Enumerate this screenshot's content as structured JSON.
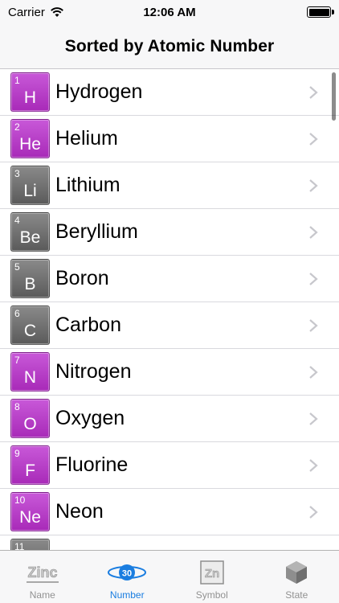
{
  "status_bar": {
    "carrier": "Carrier",
    "time": "12:06 AM"
  },
  "nav": {
    "title": "Sorted by Atomic Number"
  },
  "elements": [
    {
      "number": "1",
      "symbol": "H",
      "name": "Hydrogen",
      "category": "nonmetal"
    },
    {
      "number": "2",
      "symbol": "He",
      "name": "Helium",
      "category": "nonmetal"
    },
    {
      "number": "3",
      "symbol": "Li",
      "name": "Lithium",
      "category": "metalloid"
    },
    {
      "number": "4",
      "symbol": "Be",
      "name": "Beryllium",
      "category": "metalloid"
    },
    {
      "number": "5",
      "symbol": "B",
      "name": "Boron",
      "category": "metalloid"
    },
    {
      "number": "6",
      "symbol": "C",
      "name": "Carbon",
      "category": "metalloid"
    },
    {
      "number": "7",
      "symbol": "N",
      "name": "Nitrogen",
      "category": "nonmetal"
    },
    {
      "number": "8",
      "symbol": "O",
      "name": "Oxygen",
      "category": "nonmetal"
    },
    {
      "number": "9",
      "symbol": "F",
      "name": "Fluorine",
      "category": "nonmetal"
    },
    {
      "number": "10",
      "symbol": "Ne",
      "name": "Neon",
      "category": "nonmetal"
    },
    {
      "number": "11",
      "symbol": "",
      "name": "",
      "category": "metalloid"
    }
  ],
  "tabs": [
    {
      "label": "Name",
      "icon": "zinc-name-icon",
      "icon_text": "Zinc",
      "active": false
    },
    {
      "label": "Number",
      "icon": "atomic-number-icon",
      "icon_text": "30",
      "active": true
    },
    {
      "label": "Symbol",
      "icon": "symbol-icon",
      "icon_text": "Zn",
      "active": false
    },
    {
      "label": "State",
      "icon": "state-cube-icon",
      "icon_text": "",
      "active": false
    }
  ],
  "colors": {
    "accent": "#1a7de0",
    "nonmetal": "#b83ec8",
    "metalloid": "#707070",
    "inactive_tab": "#929292"
  }
}
